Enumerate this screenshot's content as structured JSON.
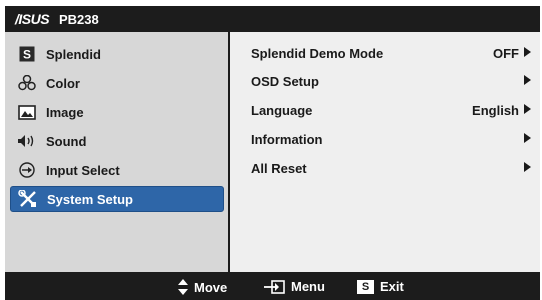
{
  "header": {
    "logo": "/ISUS",
    "model": "PB238"
  },
  "sidebar": {
    "items": [
      {
        "label": "Splendid",
        "icon": "splendid-s-icon"
      },
      {
        "label": "Color",
        "icon": "color-palette-icon"
      },
      {
        "label": "Image",
        "icon": "image-icon"
      },
      {
        "label": "Sound",
        "icon": "speaker-icon"
      },
      {
        "label": "Input Select",
        "icon": "input-select-icon"
      },
      {
        "label": "System Setup",
        "icon": "tools-icon",
        "selected": true
      }
    ]
  },
  "submenu": {
    "rows": [
      {
        "label": "Splendid Demo Mode",
        "value": "OFF"
      },
      {
        "label": "OSD Setup",
        "value": ""
      },
      {
        "label": "Language",
        "value": "English"
      },
      {
        "label": "Information",
        "value": ""
      },
      {
        "label": "All Reset",
        "value": ""
      }
    ]
  },
  "footer": {
    "move": "Move",
    "menu": "Menu",
    "exit": "Exit",
    "exit_key": "S"
  },
  "colors": {
    "header_bg": "#1c1c1c",
    "sidebar_bg": "#d7d7d7",
    "panel_bg": "#efefef",
    "selected_bg": "#2e66a8"
  }
}
